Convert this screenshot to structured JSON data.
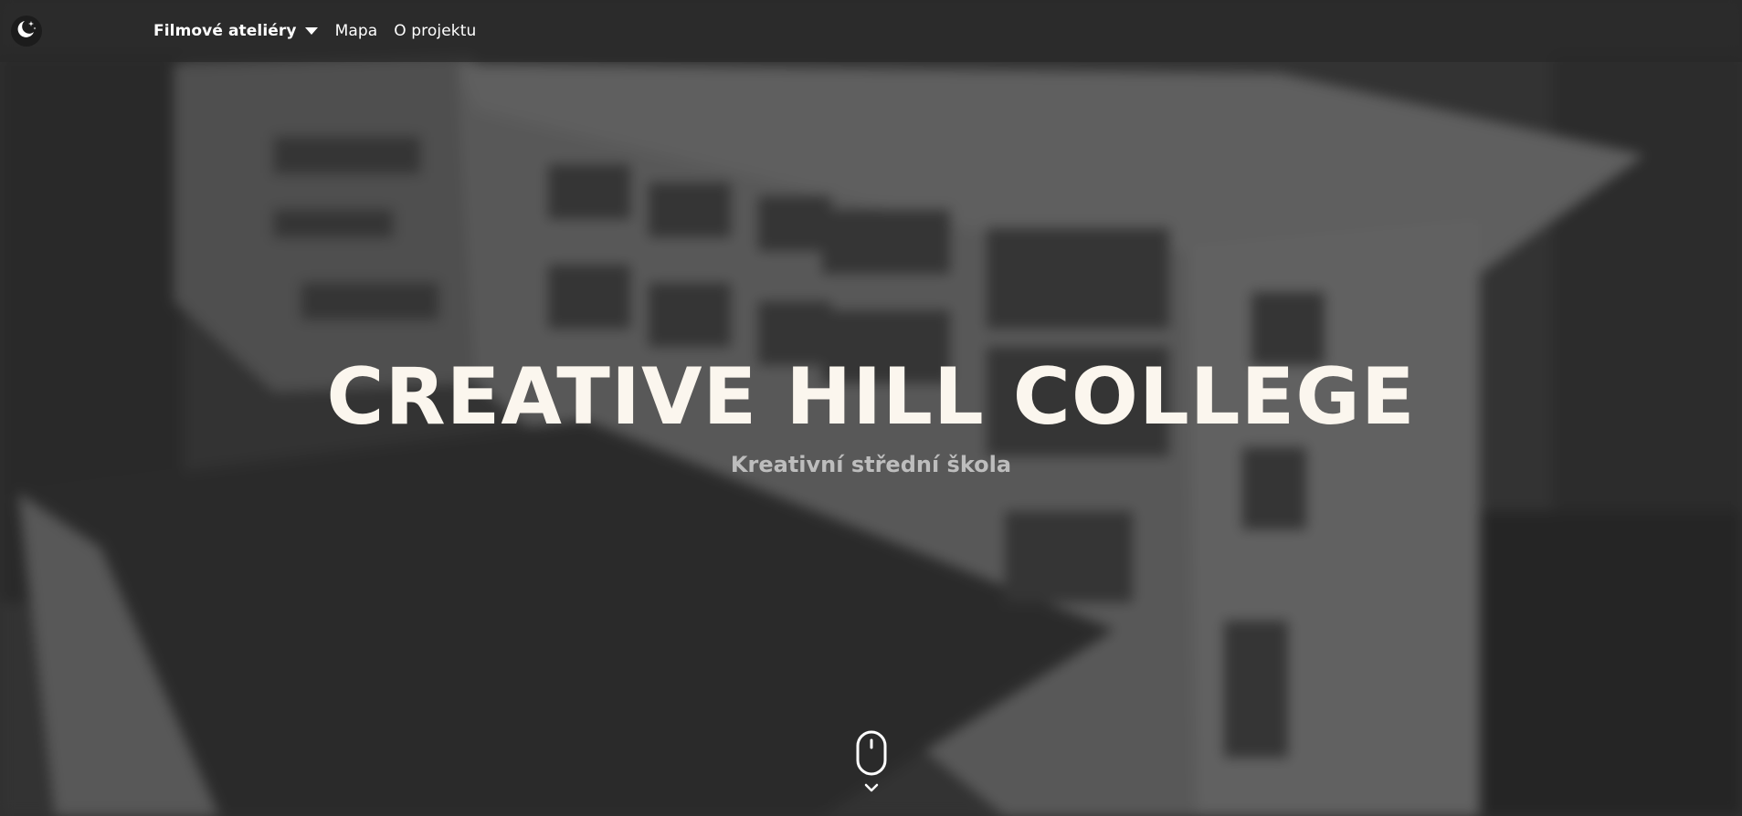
{
  "nav": {
    "theme_toggle_icon": "moon-stars-icon",
    "items": [
      {
        "label": "Filmové ateliéry",
        "has_dropdown": true
      },
      {
        "label": "Mapa",
        "has_dropdown": false
      },
      {
        "label": "O projektu",
        "has_dropdown": false
      }
    ]
  },
  "hero": {
    "title": "CREATIVE HILL COLLEGE",
    "subtitle": "Kreativní střední škola",
    "scroll_icon": "mouse-scroll-icon",
    "scroll_chevron_icon": "chevron-down-icon"
  },
  "colors": {
    "title": "#fbf6ee",
    "subtitle": "#c9c9c9",
    "navbar": "#2d2d2d"
  }
}
